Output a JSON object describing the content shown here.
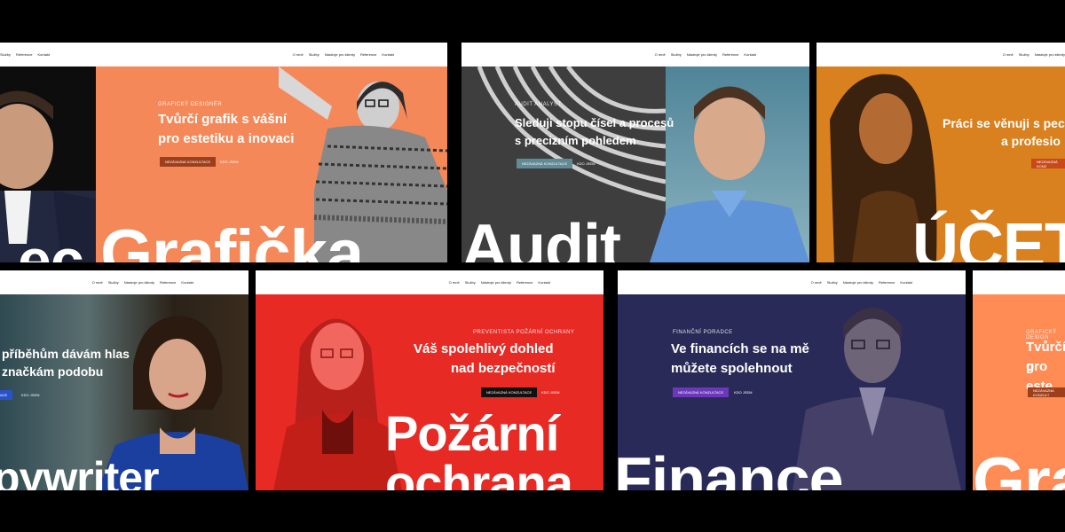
{
  "nav": {
    "o_me": "O mně",
    "sluzby": "Služby",
    "nastroje": "Nástroje pro klienty",
    "reference": "Reference",
    "kontakt": "Kontakt"
  },
  "cards": {
    "grafika": {
      "kicker": "Grafický designér",
      "headline_1": "Tvůrčí grafik s vášní",
      "headline_2": "pro estetiku a inovaci",
      "cta": "Nezávazná konzultace",
      "link": "Kdo jsem",
      "big": "Grafička"
    },
    "audit": {
      "kicker": "Audit analyst",
      "headline_1": "Sleduji stopu čísel a procesů",
      "headline_2": "s precizním pohledem",
      "cta": "Nezávazná konzultace",
      "link": "Kdo jsem",
      "big": "Audit"
    },
    "ucetni": {
      "headline_1": "Práci se věnuji s pec",
      "headline_2": "a profesio",
      "cta": "Nezávazná konz",
      "big": "ÚČET"
    },
    "partial_top_left": {
      "big": "ec"
    },
    "copywriter": {
      "headline_1": "příběhům dávám hlas",
      "headline_2": "značkám podobu",
      "cta": "ace",
      "link": "Kdo jsem",
      "big": "pywriter"
    },
    "pozarni": {
      "kicker": "Preventista požární ochrany",
      "headline_1": "Váš spolehlivý dohled",
      "headline_2": "nad bezpečností",
      "cta": "Nezávazná konzultace",
      "link": "Kdo jsem",
      "big_1": "Požární",
      "big_2": "ochrana"
    },
    "finance": {
      "kicker": "Finanční poradce",
      "headline_1": "Ve financích se na mě",
      "headline_2": "můžete spolehnout",
      "cta": "Nezávazná konzultace",
      "link": "Kdo jsem",
      "big": "Finance"
    },
    "grafika_partial": {
      "kicker": "Grafický design",
      "headline_1": "Tvůrčí g",
      "headline_2": "pro este",
      "cta": "Nezávazná konzult",
      "big": "Gra"
    }
  },
  "colors": {
    "orange": "#f58858",
    "teal": "#5d8ea0",
    "amber": "#d9801f",
    "red": "#e82a24",
    "navy": "#2a2a58",
    "peach": "#ff8b55"
  }
}
